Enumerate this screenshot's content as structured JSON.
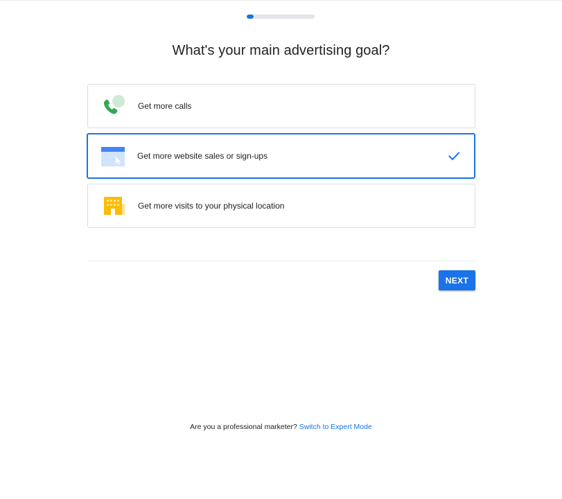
{
  "progress": {
    "value": 0.1
  },
  "page": {
    "title": "What's your main advertising goal?"
  },
  "options": [
    {
      "label": "Get more calls",
      "icon": "phone-call-icon",
      "selected": false
    },
    {
      "label": "Get more website sales or sign-ups",
      "icon": "website-icon",
      "selected": true
    },
    {
      "label": "Get more visits to your physical location",
      "icon": "storefront-icon",
      "selected": false
    }
  ],
  "actions": {
    "next_label": "NEXT"
  },
  "footer": {
    "question": "Are you a professional marketer?",
    "link_label": "Switch to Expert Mode"
  },
  "colors": {
    "accent": "#1a73e8",
    "phone_green": "#34a853",
    "bubble_green": "#ceead6",
    "storefront_yellow": "#fbbc04",
    "website_light_blue": "#d2e3fc"
  }
}
